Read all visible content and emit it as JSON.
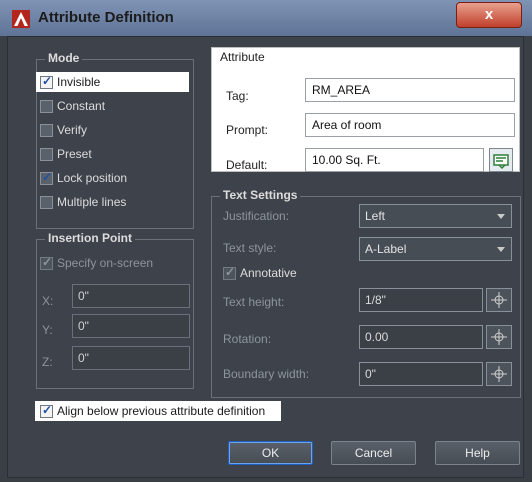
{
  "window": {
    "title": "Attribute Definition",
    "close_glyph": "x"
  },
  "mode": {
    "title": "Mode",
    "items": [
      {
        "label": "Invisible",
        "checked": true
      },
      {
        "label": "Constant",
        "checked": false
      },
      {
        "label": "Verify",
        "checked": false
      },
      {
        "label": "Preset",
        "checked": false
      },
      {
        "label": "Lock position",
        "checked": true
      },
      {
        "label": "Multiple lines",
        "checked": false
      }
    ]
  },
  "insertion": {
    "title": "Insertion Point",
    "specify_label": "Specify on-screen",
    "x_label": "X:",
    "x_value": "0\"",
    "y_label": "Y:",
    "y_value": "0\"",
    "z_label": "Z:",
    "z_value": "0\""
  },
  "attribute": {
    "title": "Attribute",
    "tag_label": "Tag:",
    "tag_value": "RM_AREA",
    "prompt_label": "Prompt:",
    "prompt_value": "Area of room",
    "default_label": "Default:",
    "default_value": "10.00 Sq. Ft."
  },
  "text_settings": {
    "title": "Text Settings",
    "justification_label": "Justification:",
    "justification_value": "Left",
    "style_label": "Text style:",
    "style_value": "A-Label",
    "annotative_label": "Annotative",
    "height_label": "Text height:",
    "height_value": "1/8\"",
    "rotation_label": "Rotation:",
    "rotation_value": "0.00",
    "boundary_label": "Boundary width:",
    "boundary_value": "0\""
  },
  "align_label": "Align below previous attribute definition",
  "buttons": {
    "ok": "OK",
    "cancel": "Cancel",
    "help": "Help"
  }
}
